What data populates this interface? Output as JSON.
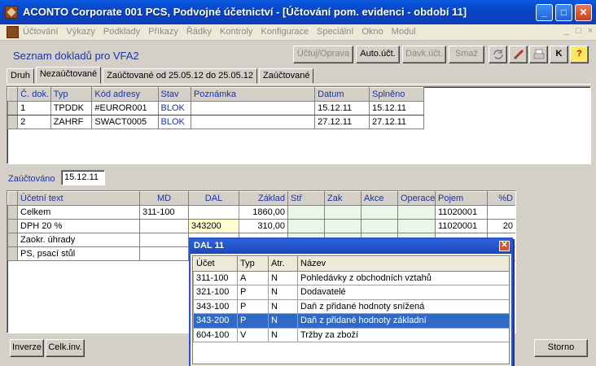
{
  "window": {
    "title": "ACONTO Corporate 001 PCS, Podvojné účetnictví - [Účtování pom. evidenci - období 11]",
    "controls": {
      "minimize": "_",
      "maximize": "□",
      "close": "✕"
    }
  },
  "menu": {
    "items": [
      "Účtování",
      "Výkazy",
      "Podklady",
      "Příkazy",
      "Řádky",
      "Kontroly",
      "Konfigurace",
      "Speciální",
      "Okno",
      "Modul"
    ],
    "mdi_buttons": [
      "_",
      "□",
      "×"
    ]
  },
  "header": {
    "title": "Seznam dokladů pro VFA2",
    "buttons": {
      "uctuj": "Účtuj/Oprava",
      "auto": "Auto.účt.",
      "davk": "Dávk.účt.",
      "smaz": "Smaž",
      "k": "K",
      "help": "?"
    }
  },
  "tabs": [
    "Druh",
    "Nezaúčtované",
    "Zaúčtované od 25.05.12 do 25.05.12",
    "Zaúčtované"
  ],
  "doc_table": {
    "columns": [
      "Č. dok.",
      "Typ",
      "Kód adresy",
      "Stav",
      "Poznámka",
      "Datum",
      "Splněno"
    ],
    "rows": [
      [
        "1",
        "TPDDK",
        "#EUROR001",
        "BLOK",
        "",
        "15.12.11",
        "15.12.11"
      ],
      [
        "2",
        "ZAHRF",
        "SWACT0005",
        "BLOK",
        "",
        "27.12.11",
        "27.12.11"
      ]
    ]
  },
  "posting": {
    "label": "Zaúčtováno",
    "date": "15.12.11"
  },
  "entry_table": {
    "columns": [
      "Účetní text",
      "MD",
      "DAL",
      "Základ",
      "Stř",
      "Zak",
      "Akce",
      "Operace",
      "Pojem",
      "%D"
    ],
    "rows": [
      [
        "Celkem",
        "311-100",
        "",
        "1860,00",
        "",
        "",
        "",
        "",
        "11020001",
        ""
      ],
      [
        "DPH 20 %",
        "",
        "343200",
        "310,00",
        "",
        "",
        "",
        "",
        "11020001",
        "20"
      ],
      [
        "Zaokr. úhrady",
        "",
        "",
        "",
        "",
        "",
        "",
        "",
        "",
        ""
      ],
      [
        "PS, psací stůl",
        "",
        "",
        "",
        "",
        "",
        "",
        "",
        "",
        ""
      ]
    ]
  },
  "bottom_buttons": {
    "inverze": "Inverze",
    "celkinv": "Celk.inv.",
    "storno": "Storno"
  },
  "popup": {
    "title": "DAL 11",
    "close": "✕",
    "columns": [
      "Účet",
      "Typ",
      "Atr.",
      "Název"
    ],
    "rows": [
      [
        "311-100",
        "A",
        "N",
        "Pohledávky z obchodních vztahů"
      ],
      [
        "321-100",
        "P",
        "N",
        "Dodavatelé"
      ],
      [
        "343-100",
        "P",
        "N",
        "Daň z přidané hodnoty snížená"
      ],
      [
        "343-200",
        "P",
        "N",
        "Daň z přidané hodnoty základní"
      ],
      [
        "604-100",
        "V",
        "N",
        "Tržby za zboží"
      ]
    ],
    "selected_index": 3
  },
  "colors": {
    "titlebar": "#0846c8",
    "header_text": "#1c32a8",
    "selection": "#316ac5"
  }
}
